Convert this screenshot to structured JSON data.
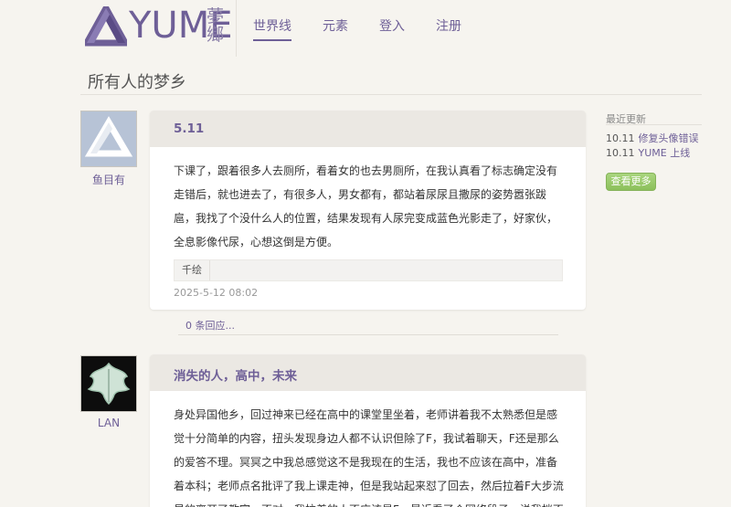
{
  "header": {
    "logo_text": "YUME",
    "logo_cn": "夢鄉",
    "nav": [
      "世界线",
      "元素",
      "登入",
      "注册"
    ]
  },
  "page_title": "所有人的梦乡",
  "posts": [
    {
      "author": "鱼目有",
      "title": "5.11",
      "body": "下课了，跟着很多人去厕所，看着女的也去男厕所，在我认真看了标志确定没有走错后，就也进去了，有很多人，男女都有，都站着尿尿且撒尿的姿势嚣张跋扈，我找了个没什么人的位置，结果发现有人尿完变成蓝色光影走了，好家伙，全息影像代尿，心想这倒是方便。",
      "tag": "千绘",
      "time": "2025-5-12 08:02",
      "replies": "0 条回应..."
    },
    {
      "author": "LAN",
      "title": "消失的人，高中，未来",
      "body": "身处异国他乡，回过神来已经在高中的课堂里坐着，老师讲着我不太熟悉但是感觉十分简单的内容，扭头发现身边人都不认识但除了F，我试着聊天，F还是那么的爱答不理。冥冥之中我总感觉这不是我现在的生活，我也不应该在高中，准备着本科；老师点名批评了我上课走神，但是我站起来怼了回去，然后拉着F大步流星的离开了教室，不对，我拉着的人不应该是F。最近看了个网络段子，说我挡不"
    }
  ],
  "sidebar": {
    "title": "最近更新",
    "items": [
      {
        "date": "10.11",
        "text": "修复头像错误"
      },
      {
        "date": "10.11",
        "text": "YUME 上线"
      }
    ],
    "button": "查看更多"
  },
  "colors": {
    "accent": "#6e5f97",
    "background": "#f6f4ef",
    "button": "#96c866"
  }
}
